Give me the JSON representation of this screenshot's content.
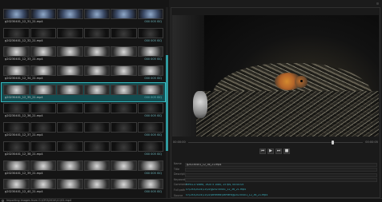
{
  "status": {
    "text": "Importing images from G:\\CR3\\2024\\11\\02.mp4"
  },
  "list": {
    "rows": [
      {
        "file": "g20230401_12_31_21.mp4",
        "time": "000 005 ISQ",
        "style": "blue"
      },
      {
        "file": "g20230401_12_32_21.mp4",
        "time": "000 005 ISQ",
        "style": "dark"
      },
      {
        "file": "g20230401_12_33_21.mp4",
        "time": "000 005 ISQ",
        "style": "bright"
      },
      {
        "file": "g20230401_12_34_21.mp4",
        "time": "000 005 ISQ",
        "style": "bright"
      },
      {
        "file": "g20230401_12_35_21.mp4",
        "time": "000 005 ISQ",
        "style": "bright"
      },
      {
        "file": "g20230401_12_36_21.mp4",
        "time": "000 005 ISQ",
        "style": "dark"
      },
      {
        "file": "g20230401_12_37_21.mp4",
        "time": "000 005 ISQ",
        "style": "dark"
      },
      {
        "file": "g20230401_12_38_21.mp4",
        "time": "000 005 ISQ",
        "style": "dark"
      },
      {
        "file": "g20230401_12_39_21.mp4",
        "time": "000 005 ISQ",
        "style": "bright"
      },
      {
        "file": "g20230401_12_40_21.mp4",
        "time": "000 005 ISQ",
        "style": "bright"
      }
    ]
  },
  "player": {
    "time_start": "00:00:00",
    "time_end": "00:00:05",
    "progress_fraction": 0.82
  },
  "controls": {
    "prev": "⏮",
    "play": "▶",
    "next": "⏭",
    "stop": "■"
  },
  "metadata": {
    "labels": [
      "Name",
      "Title",
      "Description",
      "Keywords",
      "Comment",
      "Full path",
      "Source"
    ],
    "values": [
      "g20230401_12_36_21.mp4",
      "",
      "",
      "",
      "MPEG-4 video, 1920 x 1080, 25 fps, 00:00:05",
      "G:\\CR3\\2024\\11\\02\\g20230401_12_36_21.mp4",
      "G:\\CR3\\2024\\11\\02\\birdnest\\camera\\g20230401_12_36_21.mp4"
    ]
  }
}
